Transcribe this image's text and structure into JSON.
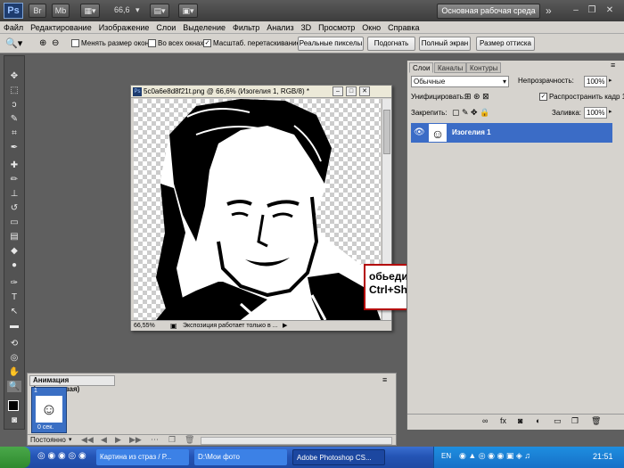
{
  "appbar": {
    "logo": "Ps",
    "zoom": "66,6",
    "workspace": "Основная рабочая среда",
    "overflow": "»"
  },
  "menu": [
    "Файл",
    "Редактирование",
    "Изображение",
    "Слои",
    "Выделение",
    "Фильтр",
    "Анализ",
    "3D",
    "Просмотр",
    "Окно",
    "Справка"
  ],
  "options": {
    "resize_windows": "Менять размер окон",
    "all_windows": "Во всех окнах",
    "scrubby_zoom": "Масштаб. перетаскиванием",
    "actual_pixels": "Реальные пикселы",
    "fit_screen": "Подогнать",
    "full_screen": "Полный экран",
    "print_size": "Размер оттиска"
  },
  "document": {
    "title": "5c0a6e8d8f21t.png @ 66,6% (Изогелия 1, RGB/8) *",
    "zoom": "66,55%",
    "status": "Экспозиция работает только в ..."
  },
  "annotation": {
    "line1": "обьединяем слои",
    "line2": "Ctrl+Shift+E"
  },
  "animation": {
    "tab": "Анимация (покадровая)",
    "frame_number": "1",
    "frame_delay": "0 сек.",
    "loop": "Постоянно"
  },
  "layers_panel": {
    "tabs": [
      "Слои",
      "Каналы",
      "Контуры"
    ],
    "blend_mode": "Обычные",
    "opacity_label": "Непрозрачность:",
    "opacity": "100%",
    "unify_label": "Унифицировать:",
    "propagate_label": "Распространить кадр 1",
    "lock_label": "Закрепить:",
    "fill_label": "Заливка:",
    "fill": "100%",
    "layer_name": "Изогелия 1"
  },
  "taskbar": {
    "items": [
      "Картина из страз / Р...",
      "D:\\Мои фото",
      "Adobe Photoshop CS..."
    ],
    "lang": "EN",
    "time": "21:51"
  },
  "colors": {
    "accent": "#3b6cc6",
    "annotation_border": "#b30000",
    "arrow": "#d00000"
  }
}
